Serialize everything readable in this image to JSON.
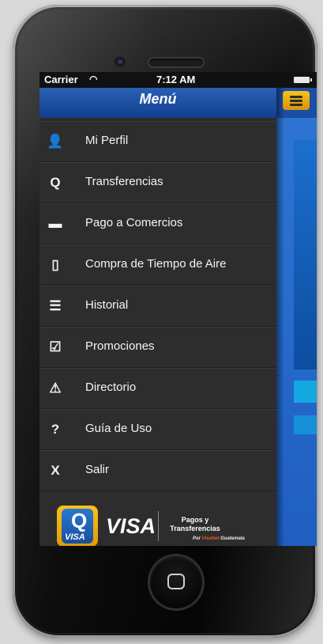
{
  "status_bar": {
    "carrier": "Carrier",
    "wifi_icon": "wifi-icon",
    "time": "7:12 AM",
    "battery_icon": "battery-icon"
  },
  "menu": {
    "title": "Menú",
    "items": [
      {
        "label": "Mi Perfil",
        "icon": "person-icon",
        "glyph": "👤"
      },
      {
        "label": "Transferencias",
        "icon": "transfer-icon",
        "glyph": "Q"
      },
      {
        "label": "Pago a Comercios",
        "icon": "card-icon",
        "glyph": "▬"
      },
      {
        "label": "Compra de Tiempo de Aire",
        "icon": "phone-icon",
        "glyph": "▯"
      },
      {
        "label": "Historial",
        "icon": "list-icon",
        "glyph": "☰"
      },
      {
        "label": "Promociones",
        "icon": "checkbox-icon",
        "glyph": "☑"
      },
      {
        "label": "Directorio",
        "icon": "warning-icon",
        "glyph": "⚠"
      },
      {
        "label": "Guía de Uso",
        "icon": "question-icon",
        "glyph": "?"
      },
      {
        "label": "Salir",
        "icon": "exit-icon",
        "glyph": "X"
      }
    ]
  },
  "footer": {
    "q_letter": "Q",
    "q_visa": "VISA",
    "visa": "VISA",
    "pagos": "Pagos y Transferencias",
    "visanet_prefix": "Por ",
    "visanet_brand": "VisaNet",
    "visanet_suffix": " Guatemala"
  },
  "colors": {
    "header_blue": "#2a60b4",
    "menu_bg": "#2d2d2d",
    "accent_yellow": "#f8c21c"
  }
}
